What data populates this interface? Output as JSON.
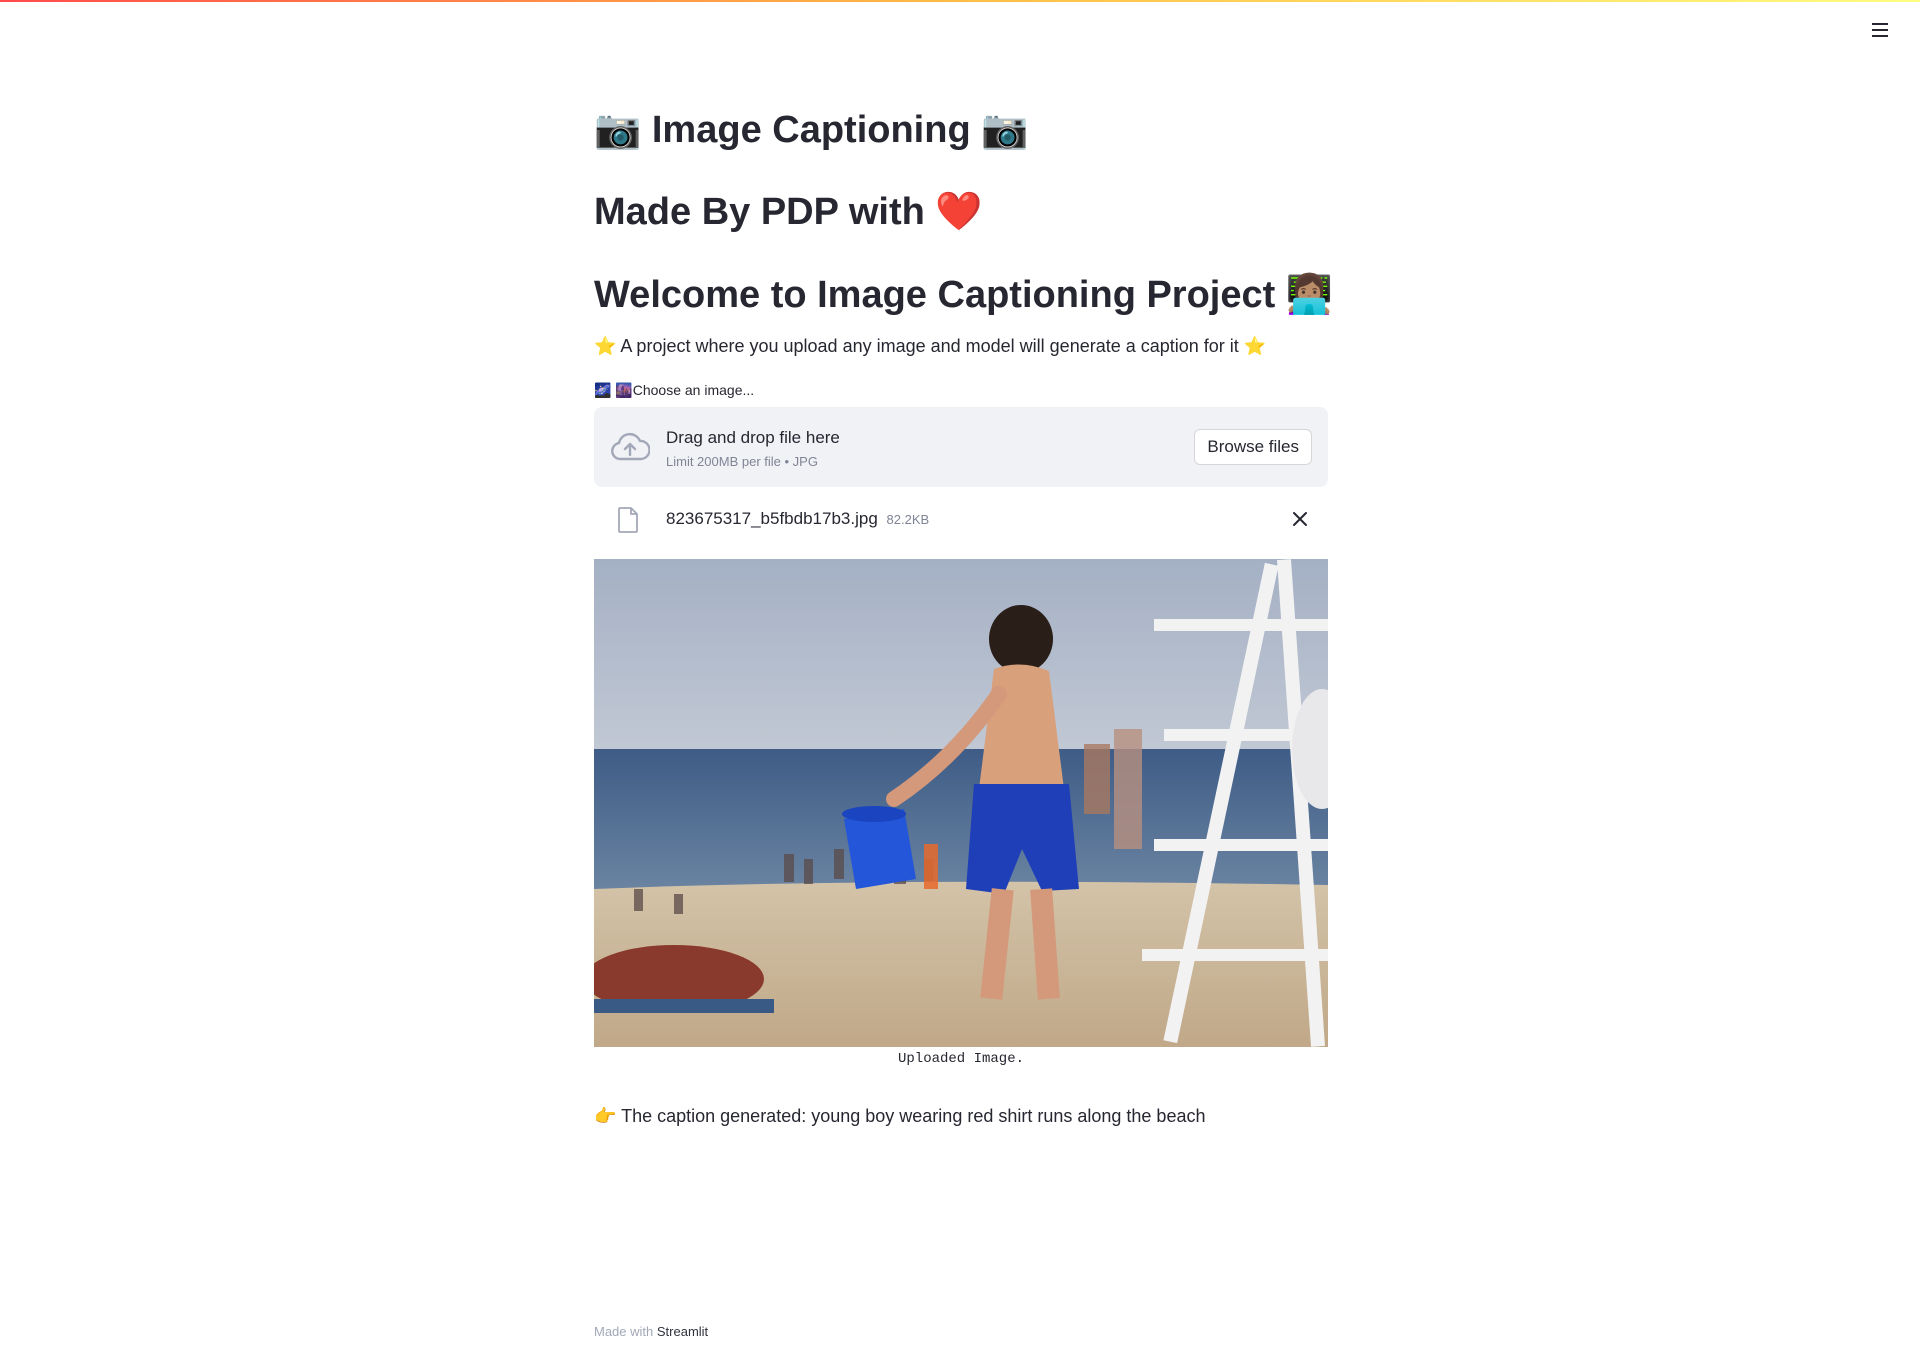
{
  "header": {
    "menu_icon": "hamburger-icon"
  },
  "title": "📷 Image Captioning 📷",
  "subtitle": "Made By PDP with ❤️",
  "welcome": "Welcome to Image Captioning Project 👩🏽‍💻",
  "description": "⭐ A project where you upload any image and model will generate a caption for it ⭐",
  "uploader": {
    "label": "🌌 🌆Choose an image...",
    "drop_title": "Drag and drop file here",
    "limit": "Limit 200MB per file • JPG",
    "browse_label": "Browse files",
    "cloud_icon": "cloud-upload-icon"
  },
  "file": {
    "name": "823675317_b5fbdb17b3.jpg",
    "size": "82.2KB",
    "icon": "file-icon",
    "remove_icon": "close-icon"
  },
  "image": {
    "caption": "Uploaded Image."
  },
  "result": "👉 The caption generated: young boy wearing red shirt runs along the beach",
  "footer": {
    "prefix": "Made with",
    "link": "Streamlit"
  }
}
